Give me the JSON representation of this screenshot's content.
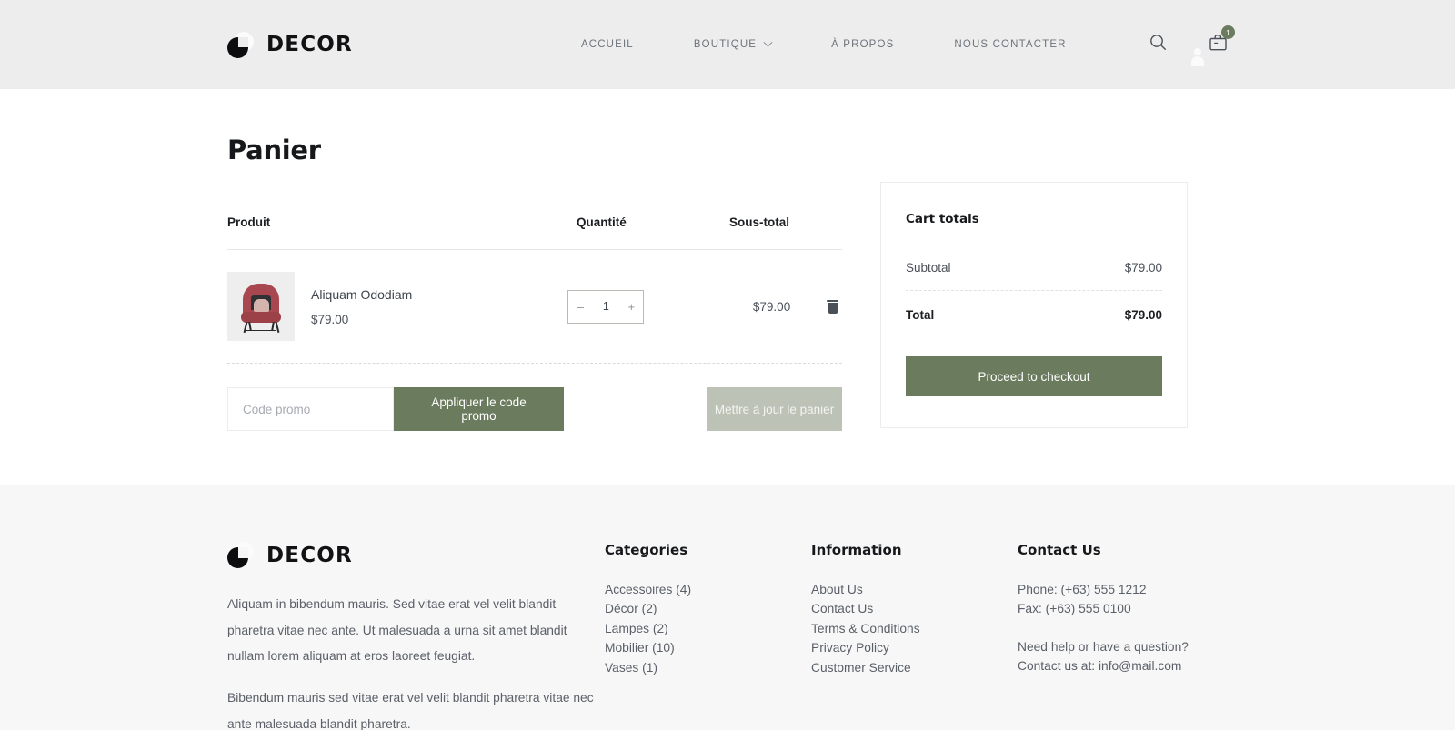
{
  "header": {
    "brand": "DECOR",
    "nav": [
      {
        "label": "ACCUEIL",
        "has_caret": false
      },
      {
        "label": "BOUTIQUE",
        "has_caret": true
      },
      {
        "label": "À PROPOS",
        "has_caret": false
      },
      {
        "label": "NOUS CONTACTER",
        "has_caret": false
      }
    ],
    "icons": {
      "search": "search-icon",
      "account": "account-icon",
      "cart": "cart-icon"
    },
    "cart_count": "1",
    "background": "#ededed"
  },
  "page": {
    "title": "Panier"
  },
  "cart": {
    "columns": {
      "product": "Produit",
      "quantity": "Quantité",
      "subtotal": "Sous-total"
    },
    "items": [
      {
        "name": "Aliquam Ododiam",
        "price": "$79.00",
        "quantity": "1",
        "subtotal": "$79.00",
        "minus": "–",
        "plus": "+"
      }
    ],
    "coupon": {
      "placeholder": "Code promo",
      "value": "",
      "apply_label": "Appliquer le code promo"
    },
    "update_label": "Mettre à jour le panier"
  },
  "totals": {
    "title": "Cart totals",
    "subtotal_label": "Subtotal",
    "subtotal_value": "$79.00",
    "total_label": "Total",
    "total_value": "$79.00",
    "checkout_label": "Proceed to checkout"
  },
  "footer": {
    "brand": "DECOR",
    "description_1": "Aliquam in bibendum mauris. Sed vitae erat vel velit blandit pharetra vitae nec ante. Ut malesuada a urna sit amet blandit nullam lorem aliquam at eros laoreet feugiat.",
    "description_2": "Bibendum mauris sed vitae erat vel velit blandit pharetra vitae nec ante malesuada blandit pharetra.",
    "categories": {
      "heading": "Categories",
      "items": [
        "Accessoires (4)",
        "Décor (2)",
        "Lampes (2)",
        "Mobilier (10)",
        "Vases (1)"
      ]
    },
    "information": {
      "heading": "Information",
      "items": [
        "About Us",
        "Contact Us",
        "Terms & Conditions",
        "Privacy Policy",
        "Customer Service"
      ]
    },
    "contact": {
      "heading": "Contact Us",
      "phone": "Phone: (+63) 555 1212",
      "fax": "Fax: (+63) 555 0100",
      "help_line": "Need help or have a question?",
      "email_line": "Contact us at: info@mail.com"
    }
  },
  "colors": {
    "accent_green": "#6b7b5e",
    "muted_green": "#bcc2b6",
    "header_bg": "#ededed",
    "footer_bg": "#f7f7f7"
  }
}
